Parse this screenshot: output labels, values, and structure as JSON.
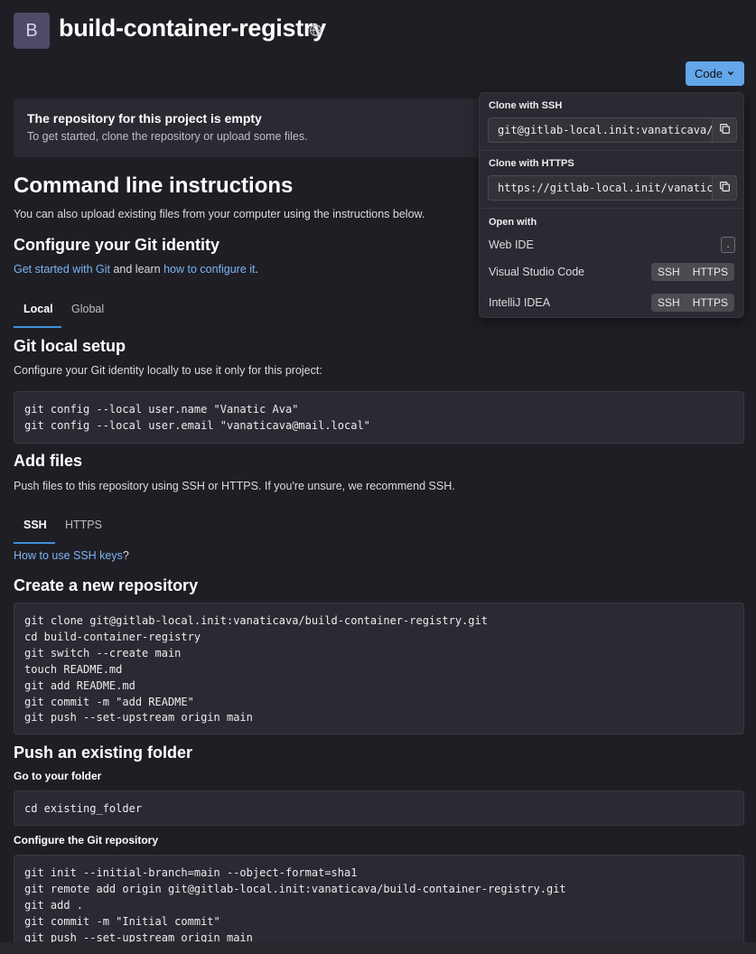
{
  "project": {
    "avatar_letter": "B",
    "title": "build-container-registry"
  },
  "code_button": {
    "label": "Code"
  },
  "alert": {
    "title": "The repository for this project is empty",
    "body": "To get started, clone the repository or upload some files."
  },
  "cli": {
    "title": "Command line instructions",
    "intro": "You can also upload existing files from your computer using the instructions below."
  },
  "identity": {
    "title": "Configure your Git identity",
    "link1": "Get started with Git",
    "mid": " and learn ",
    "link2": "how to configure it",
    "end": ".",
    "tabs": [
      "Local",
      "Global"
    ],
    "setup_title": "Git local setup",
    "setup_desc": "Configure your Git identity locally to use it only for this project:",
    "code": "git config --local user.name \"Vanatic Ava\"\ngit config --local user.email \"vanaticava@mail.local\""
  },
  "add_files": {
    "title": "Add files",
    "desc": "Push files to this repository using SSH or HTTPS. If you're unsure, we recommend SSH.",
    "tabs": [
      "SSH",
      "HTTPS"
    ],
    "ssh_link": "How to use SSH keys",
    "ssh_link_end": "?"
  },
  "new_repo": {
    "title": "Create a new repository",
    "code": "git clone git@gitlab-local.init:vanaticava/build-container-registry.git\ncd build-container-registry\ngit switch --create main\ntouch README.md\ngit add README.md\ngit commit -m \"add README\"\ngit push --set-upstream origin main"
  },
  "existing_folder": {
    "title": "Push an existing folder",
    "step1": "Go to your folder",
    "code1": "cd existing_folder",
    "step2": "Configure the Git repository",
    "code2": "git init --initial-branch=main --object-format=sha1\ngit remote add origin git@gitlab-local.init:vanaticava/build-container-registry.git\ngit add .\ngit commit -m \"Initial commit\"\ngit push --set-upstream origin main"
  },
  "dropdown": {
    "ssh_label": "Clone with SSH",
    "ssh_url": "git@gitlab-local.init:vanaticava/build-container-registry.git",
    "https_label": "Clone with HTTPS",
    "https_url": "https://gitlab-local.init/vanaticava/build-container-registry.git",
    "open_with": "Open with",
    "web_ide": "Web IDE",
    "web_ide_shortcut": ".",
    "vscode": "Visual Studio Code",
    "intellij": "IntelliJ IDEA",
    "ssh": "SSH",
    "https": "HTTPS"
  },
  "colors": {
    "background": "#1f1e24",
    "accent": "#63a6e9",
    "link": "#7cb4f5"
  }
}
